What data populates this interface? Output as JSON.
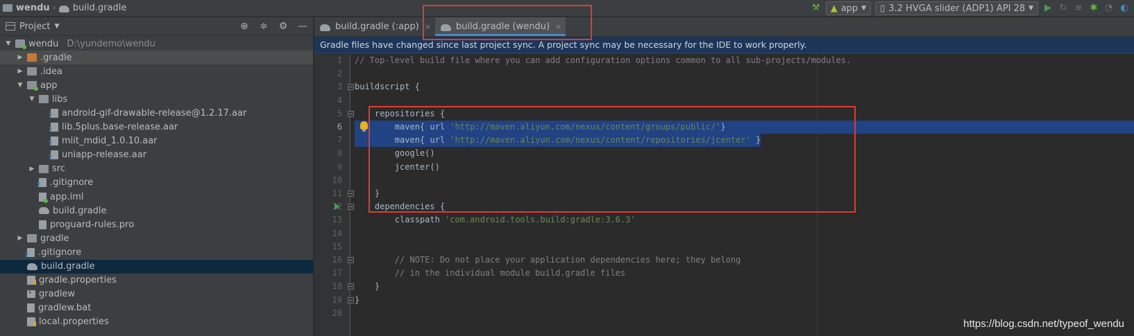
{
  "breadcrumb": {
    "project": "wendu",
    "file": "build.gradle"
  },
  "toolbar": {
    "run_config": "app",
    "device": "3.2  HVGA slider (ADP1) API 28"
  },
  "project_panel": {
    "title": "Project",
    "tree": [
      {
        "label": "wendu",
        "path": "D:\\yundemo\\wendu",
        "depth": 0,
        "arrow": "▼",
        "icon": "module"
      },
      {
        "label": ".gradle",
        "depth": 1,
        "arrow": "▶",
        "icon": "folder-orange",
        "highlighted": true
      },
      {
        "label": ".idea",
        "depth": 1,
        "arrow": "▶",
        "icon": "folder"
      },
      {
        "label": "app",
        "depth": 1,
        "arrow": "▼",
        "icon": "module"
      },
      {
        "label": "libs",
        "depth": 2,
        "arrow": "▼",
        "icon": "folder"
      },
      {
        "label": "android-gif-drawable-release@1.2.17.aar",
        "depth": 3,
        "arrow": "",
        "icon": "file-q"
      },
      {
        "label": "lib.5plus.base-release.aar",
        "depth": 3,
        "arrow": "",
        "icon": "file-q"
      },
      {
        "label": "miit_mdid_1.0.10.aar",
        "depth": 3,
        "arrow": "",
        "icon": "file-q"
      },
      {
        "label": "uniapp-release.aar",
        "depth": 3,
        "arrow": "",
        "icon": "file-q"
      },
      {
        "label": "src",
        "depth": 2,
        "arrow": "▶",
        "icon": "folder"
      },
      {
        "label": ".gitignore",
        "depth": 2,
        "arrow": "",
        "icon": "file-q"
      },
      {
        "label": "app.iml",
        "depth": 2,
        "arrow": "",
        "icon": "iml"
      },
      {
        "label": "build.gradle",
        "depth": 2,
        "arrow": "",
        "icon": "gradle"
      },
      {
        "label": "proguard-rules.pro",
        "depth": 2,
        "arrow": "",
        "icon": "file"
      },
      {
        "label": "gradle",
        "depth": 1,
        "arrow": "▶",
        "icon": "folder"
      },
      {
        "label": ".gitignore",
        "depth": 1,
        "arrow": "",
        "icon": "file-q"
      },
      {
        "label": "build.gradle",
        "depth": 1,
        "arrow": "",
        "icon": "gradle",
        "selected": true
      },
      {
        "label": "gradle.properties",
        "depth": 1,
        "arrow": "",
        "icon": "props"
      },
      {
        "label": "gradlew",
        "depth": 1,
        "arrow": "",
        "icon": "term"
      },
      {
        "label": "gradlew.bat",
        "depth": 1,
        "arrow": "",
        "icon": "file"
      },
      {
        "label": "local.properties",
        "depth": 1,
        "arrow": "",
        "icon": "props"
      }
    ]
  },
  "editor": {
    "tabs": [
      {
        "label": "build.gradle (:app)",
        "active": false
      },
      {
        "label": "build.gradle (wendu)",
        "active": true
      }
    ],
    "banner": "Gradle files have changed since last project sync. A project sync may be necessary for the IDE to work properly.",
    "lines": [
      {
        "n": "1",
        "parts": [
          [
            "cm",
            "// Top-level build file where you can add configuration options common to all sub-projects/modules."
          ]
        ]
      },
      {
        "n": "2",
        "parts": []
      },
      {
        "n": "3",
        "parts": [
          [
            "",
            "buildscript {"
          ]
        ],
        "fold": true
      },
      {
        "n": "4",
        "parts": []
      },
      {
        "n": "5",
        "parts": [
          [
            "",
            "    repositories {"
          ]
        ],
        "fold": true
      },
      {
        "n": "6",
        "parts": [
          [
            "",
            "        maven{ url "
          ],
          [
            "str",
            "'http://maven.aliyun.com/nexus/content/groups/public/'"
          ],
          [
            "",
            "}"
          ]
        ],
        "selected": true,
        "current": true,
        "bulb": true
      },
      {
        "n": "7",
        "parts": [
          [
            "",
            "        maven{ url "
          ],
          [
            "str",
            "'http://maven.aliyun.com/nexus/content/repositories/jcenter'"
          ],
          [
            "",
            " }"
          ]
        ],
        "selected": true
      },
      {
        "n": "8",
        "parts": [
          [
            "",
            "        google()"
          ]
        ]
      },
      {
        "n": "9",
        "parts": [
          [
            "",
            "        jcenter()"
          ]
        ]
      },
      {
        "n": "10",
        "parts": []
      },
      {
        "n": "11",
        "parts": [
          [
            "",
            "    }"
          ]
        ],
        "fold": true
      },
      {
        "n": "12",
        "parts": [
          [
            "",
            "    dependencies {"
          ]
        ],
        "fold": true,
        "run": true
      },
      {
        "n": "13",
        "parts": [
          [
            "",
            "        classpath "
          ],
          [
            "str",
            "'com.android.tools.build:gradle:3.6.3'"
          ]
        ]
      },
      {
        "n": "14",
        "parts": []
      },
      {
        "n": "15",
        "parts": []
      },
      {
        "n": "16",
        "parts": [
          [
            "cm",
            "        // NOTE: Do not place your application dependencies here; they belong"
          ]
        ],
        "fold": true
      },
      {
        "n": "17",
        "parts": [
          [
            "cm",
            "        // in the individual module build.gradle files"
          ]
        ]
      },
      {
        "n": "18",
        "parts": [
          [
            "",
            "    }"
          ]
        ],
        "fold": true
      },
      {
        "n": "19",
        "parts": [
          [
            "",
            "}"
          ]
        ],
        "fold": true
      },
      {
        "n": "20",
        "parts": []
      }
    ]
  },
  "watermark": "https://blog.csdn.net/typeof_wendu"
}
